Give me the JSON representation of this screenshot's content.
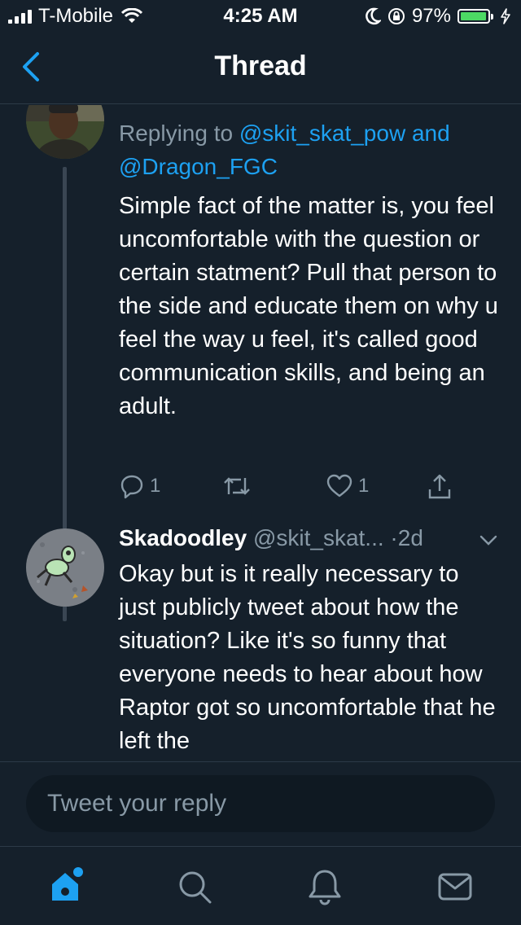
{
  "status_bar": {
    "carrier": "T-Mobile",
    "time": "4:25 AM",
    "battery": "97%",
    "battery_level": 0.97
  },
  "header": {
    "title": "Thread",
    "back_icon": "chevron-left-icon"
  },
  "thread": {
    "tweet1": {
      "replying_to_prefix": "Replying to ",
      "mention_1": "@skit_skat_pow",
      "mention_joiner": " and",
      "mention_2": "@Dragon_FGC",
      "text": "Simple fact of the matter is, you feel uncomfortable with the question or certain statment? Pull that person to the side and educate them on why u feel the way u feel, it's called good communication skills, and being an adult.",
      "reply_count": "1",
      "like_count": "1"
    },
    "tweet2": {
      "display_name": "Skadoodley",
      "handle": " @skit_skat...",
      "time": " ·2d",
      "text": "Okay but is it really necessary to just publicly tweet about how the situation? Like it's so funny that everyone needs to hear about how Raptor got so uncomfortable that he left the"
    }
  },
  "composer": {
    "placeholder": "Tweet your reply"
  },
  "tabs": [
    "home-icon",
    "search-icon",
    "notifications-icon",
    "messages-icon"
  ],
  "colors": {
    "background": "#15202b",
    "accent": "#1da1f2",
    "secondary_text": "#8899a6"
  }
}
